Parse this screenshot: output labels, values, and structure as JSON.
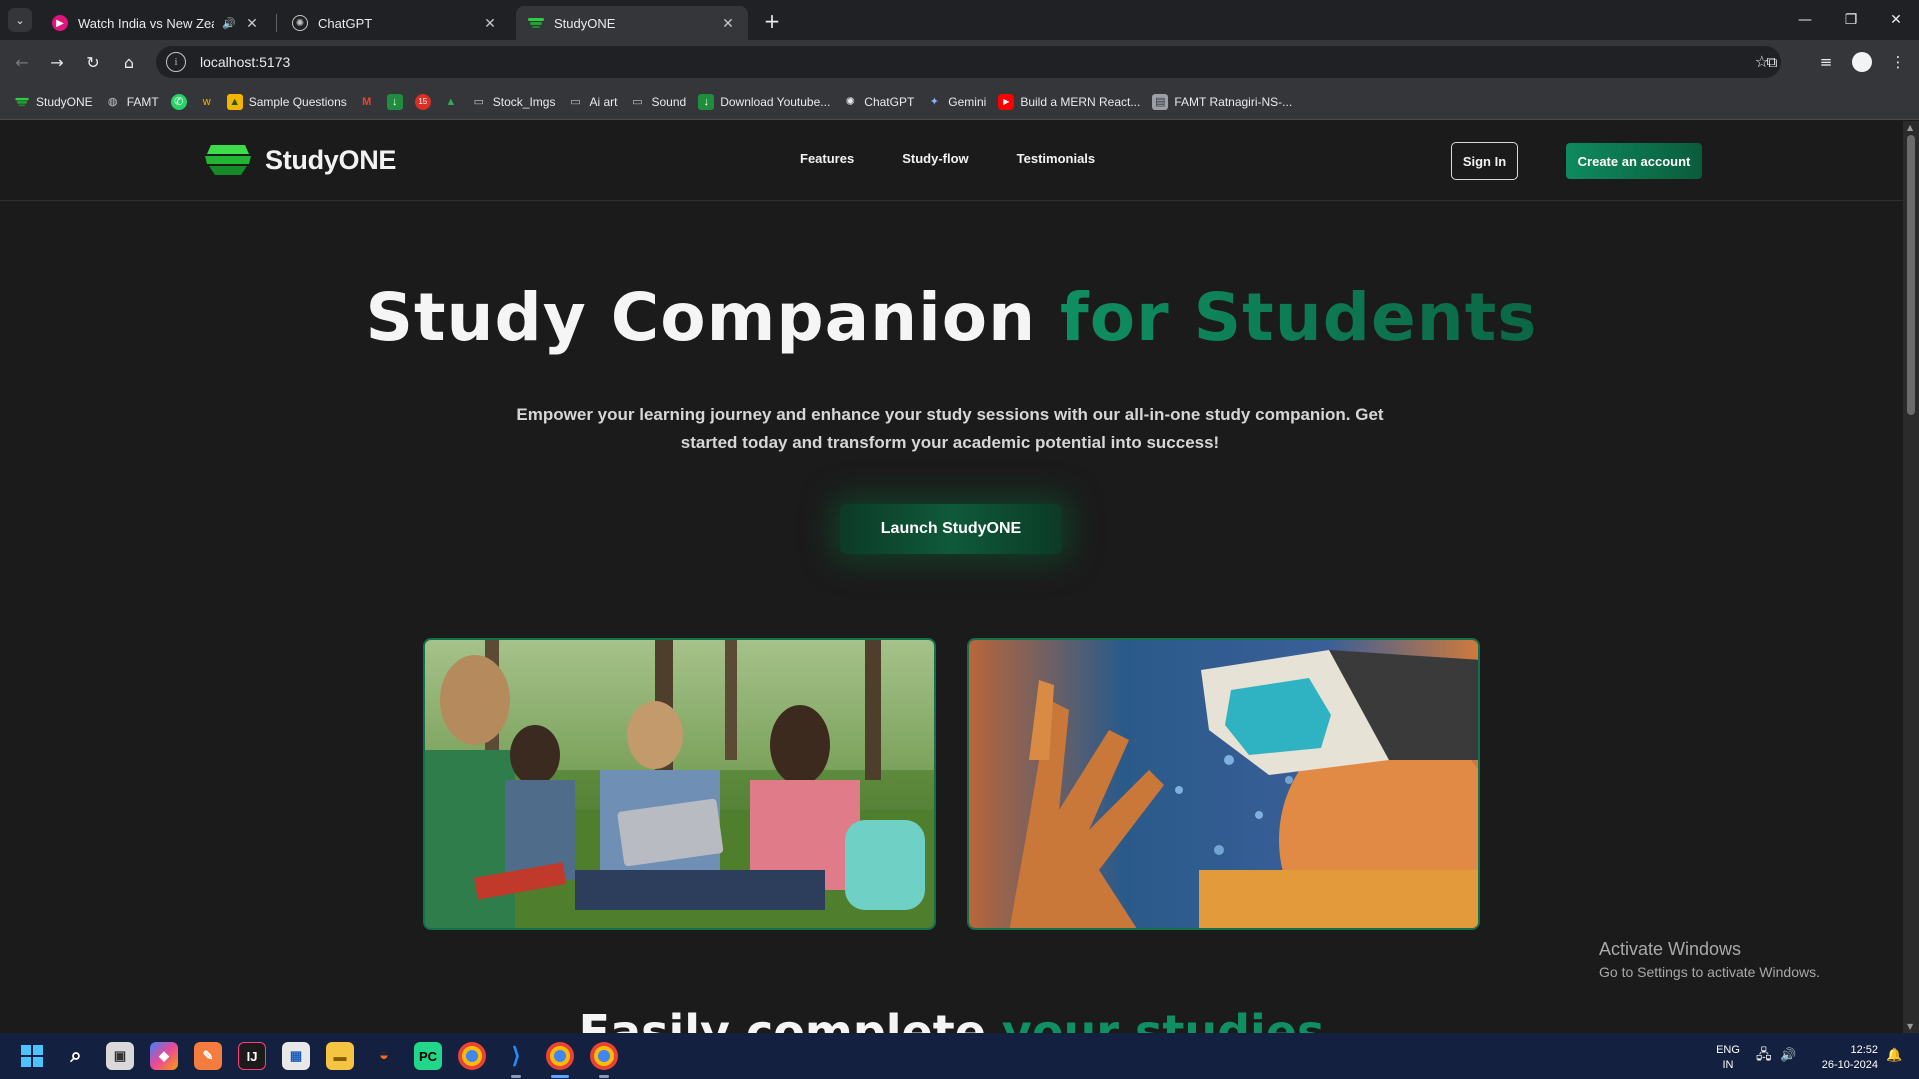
{
  "browser": {
    "tabs": [
      {
        "title": "Watch India vs New Zealand",
        "active": false,
        "audio": true
      },
      {
        "title": "ChatGPT",
        "active": false,
        "audio": false
      },
      {
        "title": "StudyONE",
        "active": true,
        "audio": false
      }
    ],
    "url": "localhost:5173",
    "bookmarks": [
      {
        "label": "StudyONE",
        "icon": "studyone-icon"
      },
      {
        "label": "FAMT",
        "icon": "globe-icon"
      },
      {
        "label": "",
        "icon": "whatsapp-icon"
      },
      {
        "label": "",
        "icon": "bookmark-icon"
      },
      {
        "label": "Sample Questions",
        "icon": "image-icon"
      },
      {
        "label": "",
        "icon": "gmail-icon"
      },
      {
        "label": "",
        "icon": "download-icon"
      },
      {
        "label": "",
        "icon": "calendar-icon"
      },
      {
        "label": "",
        "icon": "drive-icon"
      },
      {
        "label": "Stock_Imgs",
        "icon": "folder-icon"
      },
      {
        "label": "Ai art",
        "icon": "folder-icon"
      },
      {
        "label": "Sound",
        "icon": "folder-icon"
      },
      {
        "label": "Download Youtube...",
        "icon": "download-icon"
      },
      {
        "label": "ChatGPT",
        "icon": "openai-icon"
      },
      {
        "label": "Gemini",
        "icon": "gemini-icon"
      },
      {
        "label": "Build a MERN React...",
        "icon": "youtube-icon"
      },
      {
        "label": "FAMT Ratnagiri-NS-...",
        "icon": "page-icon"
      }
    ]
  },
  "site": {
    "brand": "StudyONE",
    "nav": [
      "Features",
      "Study-flow",
      "Testimonials"
    ],
    "sign_in": "Sign In",
    "create_account": "Create an account",
    "hero": {
      "title_main": "Study Companion",
      "title_accent": "for Students",
      "subtitle": "Empower your learning journey and enhance your study sessions with our all-in-one study companion. Get started today and transform your academic potential into success!",
      "cta": "Launch StudyONE"
    },
    "section": {
      "title_main": "Easily complete",
      "title_accent": "your studies"
    },
    "colors": {
      "accent": "#0f8f62",
      "background": "#1b1b1b"
    }
  },
  "windows": {
    "activate_title": "Activate Windows",
    "activate_sub": "Go to Settings to activate Windows.",
    "lang_top": "ENG",
    "lang_bottom": "IN",
    "time": "12:52",
    "date": "26-10-2024"
  }
}
